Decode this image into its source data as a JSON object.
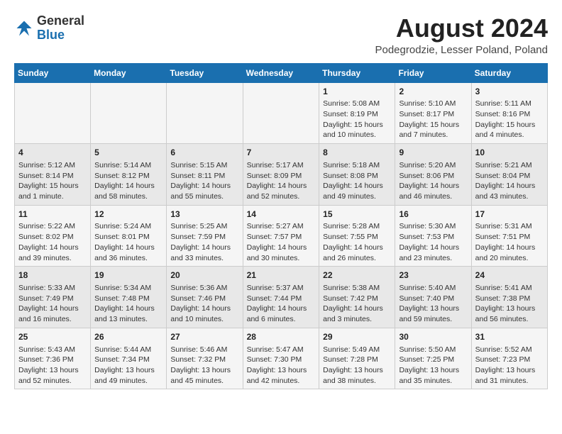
{
  "header": {
    "logo_general": "General",
    "logo_blue": "Blue",
    "month_year": "August 2024",
    "location": "Podegrodzie, Lesser Poland, Poland"
  },
  "weekdays": [
    "Sunday",
    "Monday",
    "Tuesday",
    "Wednesday",
    "Thursday",
    "Friday",
    "Saturday"
  ],
  "weeks": [
    [
      {
        "day": "",
        "info": ""
      },
      {
        "day": "",
        "info": ""
      },
      {
        "day": "",
        "info": ""
      },
      {
        "day": "",
        "info": ""
      },
      {
        "day": "1",
        "info": "Sunrise: 5:08 AM\nSunset: 8:19 PM\nDaylight: 15 hours\nand 10 minutes."
      },
      {
        "day": "2",
        "info": "Sunrise: 5:10 AM\nSunset: 8:17 PM\nDaylight: 15 hours\nand 7 minutes."
      },
      {
        "day": "3",
        "info": "Sunrise: 5:11 AM\nSunset: 8:16 PM\nDaylight: 15 hours\nand 4 minutes."
      }
    ],
    [
      {
        "day": "4",
        "info": "Sunrise: 5:12 AM\nSunset: 8:14 PM\nDaylight: 15 hours\nand 1 minute."
      },
      {
        "day": "5",
        "info": "Sunrise: 5:14 AM\nSunset: 8:12 PM\nDaylight: 14 hours\nand 58 minutes."
      },
      {
        "day": "6",
        "info": "Sunrise: 5:15 AM\nSunset: 8:11 PM\nDaylight: 14 hours\nand 55 minutes."
      },
      {
        "day": "7",
        "info": "Sunrise: 5:17 AM\nSunset: 8:09 PM\nDaylight: 14 hours\nand 52 minutes."
      },
      {
        "day": "8",
        "info": "Sunrise: 5:18 AM\nSunset: 8:08 PM\nDaylight: 14 hours\nand 49 minutes."
      },
      {
        "day": "9",
        "info": "Sunrise: 5:20 AM\nSunset: 8:06 PM\nDaylight: 14 hours\nand 46 minutes."
      },
      {
        "day": "10",
        "info": "Sunrise: 5:21 AM\nSunset: 8:04 PM\nDaylight: 14 hours\nand 43 minutes."
      }
    ],
    [
      {
        "day": "11",
        "info": "Sunrise: 5:22 AM\nSunset: 8:02 PM\nDaylight: 14 hours\nand 39 minutes."
      },
      {
        "day": "12",
        "info": "Sunrise: 5:24 AM\nSunset: 8:01 PM\nDaylight: 14 hours\nand 36 minutes."
      },
      {
        "day": "13",
        "info": "Sunrise: 5:25 AM\nSunset: 7:59 PM\nDaylight: 14 hours\nand 33 minutes."
      },
      {
        "day": "14",
        "info": "Sunrise: 5:27 AM\nSunset: 7:57 PM\nDaylight: 14 hours\nand 30 minutes."
      },
      {
        "day": "15",
        "info": "Sunrise: 5:28 AM\nSunset: 7:55 PM\nDaylight: 14 hours\nand 26 minutes."
      },
      {
        "day": "16",
        "info": "Sunrise: 5:30 AM\nSunset: 7:53 PM\nDaylight: 14 hours\nand 23 minutes."
      },
      {
        "day": "17",
        "info": "Sunrise: 5:31 AM\nSunset: 7:51 PM\nDaylight: 14 hours\nand 20 minutes."
      }
    ],
    [
      {
        "day": "18",
        "info": "Sunrise: 5:33 AM\nSunset: 7:49 PM\nDaylight: 14 hours\nand 16 minutes."
      },
      {
        "day": "19",
        "info": "Sunrise: 5:34 AM\nSunset: 7:48 PM\nDaylight: 14 hours\nand 13 minutes."
      },
      {
        "day": "20",
        "info": "Sunrise: 5:36 AM\nSunset: 7:46 PM\nDaylight: 14 hours\nand 10 minutes."
      },
      {
        "day": "21",
        "info": "Sunrise: 5:37 AM\nSunset: 7:44 PM\nDaylight: 14 hours\nand 6 minutes."
      },
      {
        "day": "22",
        "info": "Sunrise: 5:38 AM\nSunset: 7:42 PM\nDaylight: 14 hours\nand 3 minutes."
      },
      {
        "day": "23",
        "info": "Sunrise: 5:40 AM\nSunset: 7:40 PM\nDaylight: 13 hours\nand 59 minutes."
      },
      {
        "day": "24",
        "info": "Sunrise: 5:41 AM\nSunset: 7:38 PM\nDaylight: 13 hours\nand 56 minutes."
      }
    ],
    [
      {
        "day": "25",
        "info": "Sunrise: 5:43 AM\nSunset: 7:36 PM\nDaylight: 13 hours\nand 52 minutes."
      },
      {
        "day": "26",
        "info": "Sunrise: 5:44 AM\nSunset: 7:34 PM\nDaylight: 13 hours\nand 49 minutes."
      },
      {
        "day": "27",
        "info": "Sunrise: 5:46 AM\nSunset: 7:32 PM\nDaylight: 13 hours\nand 45 minutes."
      },
      {
        "day": "28",
        "info": "Sunrise: 5:47 AM\nSunset: 7:30 PM\nDaylight: 13 hours\nand 42 minutes."
      },
      {
        "day": "29",
        "info": "Sunrise: 5:49 AM\nSunset: 7:28 PM\nDaylight: 13 hours\nand 38 minutes."
      },
      {
        "day": "30",
        "info": "Sunrise: 5:50 AM\nSunset: 7:25 PM\nDaylight: 13 hours\nand 35 minutes."
      },
      {
        "day": "31",
        "info": "Sunrise: 5:52 AM\nSunset: 7:23 PM\nDaylight: 13 hours\nand 31 minutes."
      }
    ]
  ]
}
